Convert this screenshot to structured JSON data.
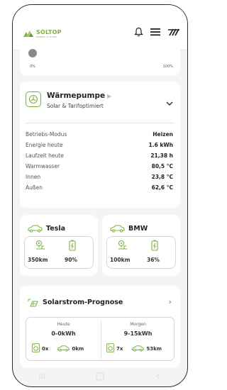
{
  "brand": {
    "name": "SOLTOP",
    "tagline": "ENERGY SYSTEM",
    "color": "#7bb541"
  },
  "header": {
    "icons": [
      "bell-icon",
      "menu-icon",
      "heat-pump-brand-icon"
    ]
  },
  "slider": {
    "min_label": "0%",
    "max_label": "100%",
    "value": 0
  },
  "heatpump": {
    "title": "Wärmepumpe",
    "subtitle": "Solar & Tarifoptimiert",
    "rows": [
      {
        "label": "Betriebs-Modus",
        "value": "Heizen"
      },
      {
        "label": "Energie heute",
        "value": "1.6 kWh"
      },
      {
        "label": "Laufzeit heute",
        "value": "21,38 h"
      },
      {
        "label": "Warmwasser",
        "value": "80,5 °C"
      },
      {
        "label": "Innen",
        "value": "23,8 °C"
      },
      {
        "label": "Außen",
        "value": "62,6 °C"
      }
    ]
  },
  "cars": [
    {
      "name": "Tesla",
      "range": "350km",
      "battery": "90%"
    },
    {
      "name": "BMW",
      "range": "100km",
      "battery": "36%"
    }
  ],
  "solar": {
    "title": "Solarstrom-Prognose",
    "today": {
      "label": "Heute",
      "kwh": "0-0kWh",
      "washes": "0x",
      "km": "0km"
    },
    "tomorrow": {
      "label": "Morgen",
      "kwh": "9-15kWh",
      "washes": "7x",
      "km": "53km"
    }
  },
  "navbar": {
    "icons": [
      "recent-apps-icon",
      "home-icon",
      "back-icon"
    ]
  }
}
